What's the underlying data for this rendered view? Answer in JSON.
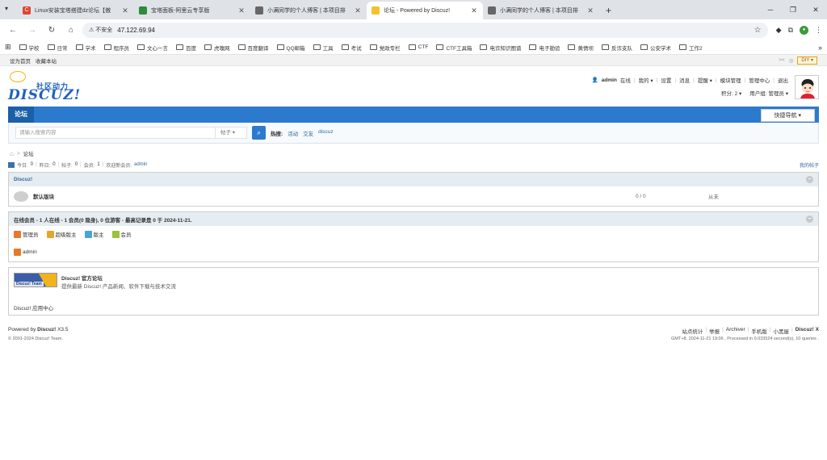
{
  "browser": {
    "tabs": [
      {
        "title": "Linux安装宝塔搭建dz论坛【傲",
        "fav_color": "#e0452f",
        "fav_letter": "C"
      },
      {
        "title": "宝塔面板-阿里云专享版",
        "fav_color": "#2e8b3a",
        "fav_letter": ""
      },
      {
        "title": "小满同学的个人博客 | 本项目排",
        "fav_color": "#666666",
        "fav_letter": ""
      },
      {
        "title": "论坛 - Powered by Discuz!",
        "fav_color": "#f2c12e",
        "fav_letter": ""
      },
      {
        "title": "小满同学的个人博客 | 本项目排",
        "fav_color": "#666666",
        "fav_letter": ""
      }
    ],
    "active_tab": 3,
    "security_label": "不安全",
    "url": "47.122.69.94",
    "bookmarks": [
      "学校",
      "日常",
      "学术",
      "程序员",
      "文心一言",
      "百度",
      "虎嗅网",
      "百度翻译",
      "QQ邮箱",
      "工具",
      "考试",
      "党政专栏",
      "CTF",
      "CTF工具箱",
      "电诈知识图谱",
      "电子勘验",
      "黄情坝",
      "反诈支队",
      "公安学术",
      "工作2"
    ],
    "bookmarks_more": "»"
  },
  "topbar": {
    "left": [
      "设为首页",
      "收藏本站"
    ],
    "diy": "DIY"
  },
  "header": {
    "logo_zh": "社区动力",
    "logo_en": "DISCUZ!",
    "user": {
      "name": "admin",
      "status": "在线",
      "links": [
        "我的",
        "设置",
        "消息",
        "提醒",
        "模块管理",
        "管理中心",
        "退出"
      ],
      "credits_label": "积分: 2",
      "group_label": "用户组: 管理员"
    }
  },
  "nav": {
    "current": "论坛",
    "quick_nav": "快捷导航"
  },
  "search": {
    "placeholder": "请输入搜索内容",
    "type": "帖子",
    "hot_label": "热搜:",
    "hot": [
      "活动",
      "交友",
      "discuz"
    ]
  },
  "breadcrumb": {
    "home_icon": "home-icon",
    "sep": ">",
    "current": "论坛"
  },
  "stats": {
    "today_label": "今日:",
    "today": "0",
    "yesterday_label": "昨日:",
    "yesterday": "0",
    "posts_label": "帖子:",
    "posts": "0",
    "members_label": "会员:",
    "members": "1",
    "welcome_label": "欢迎新会员:",
    "newest": "admin",
    "my_posts": "我的帖子"
  },
  "forum_group": {
    "title": "Discuz!",
    "forums": [
      {
        "name": "默认版块",
        "count": "0 / 0",
        "last": "从未"
      }
    ]
  },
  "online": {
    "title": "在线会员 - 1 人在线 - 1 会员(0 隐身), 0 位游客 - 最高记录是 0 于 2024-11-21.",
    "legend": [
      {
        "label": "管理员",
        "color": "#e5792d"
      },
      {
        "label": "超级版主",
        "color": "#e5a52d"
      },
      {
        "label": "版主",
        "color": "#4aa3d6"
      },
      {
        "label": "会员",
        "color": "#9ac23c"
      }
    ],
    "members": [
      {
        "name": "admin",
        "color": "#e5792d"
      }
    ]
  },
  "links": {
    "logo_text": "Discuz! Team",
    "title": "Discuz! 官方论坛",
    "desc": "提供最新 Discuz! 产品新闻、软件下载与技术交流",
    "app_center": "Discuz! 应用中心"
  },
  "footer": {
    "powered_prefix": "Powered by",
    "powered_brand": "Discuz!",
    "version": "X3.5",
    "copyright": "© 2001-2024 Discuz! Team.",
    "links": [
      "站点统计",
      "举报",
      "Archiver",
      "手机版",
      "小黑屋"
    ],
    "brand": "Discuz! X",
    "processed": "GMT+8, 2024-11-21 19:06 , Processed in 0.033524 second(s), 10 queries ."
  }
}
